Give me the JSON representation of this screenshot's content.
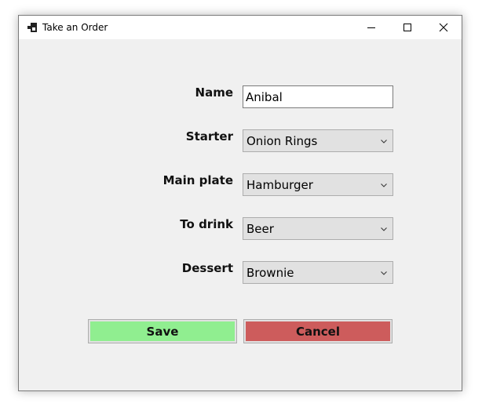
{
  "window": {
    "title": "Take an Order"
  },
  "form": {
    "name": {
      "label": "Name",
      "value": "Anibal"
    },
    "starter": {
      "label": "Starter",
      "value": "Onion Rings"
    },
    "main_plate": {
      "label": "Main plate",
      "value": "Hamburger"
    },
    "to_drink": {
      "label": "To drink",
      "value": "Beer"
    },
    "dessert": {
      "label": "Dessert",
      "value": "Brownie"
    }
  },
  "buttons": {
    "save_label": "Save",
    "cancel_label": "Cancel"
  },
  "colors": {
    "save_bg": "#90ee90",
    "cancel_bg": "#cd5c5c",
    "window_bg": "#f0f0f0"
  },
  "icons": {
    "app": "app-window-icon",
    "minimize": "minimize-icon",
    "maximize": "maximize-icon",
    "close": "close-icon",
    "dropdown": "chevron-down-icon"
  }
}
